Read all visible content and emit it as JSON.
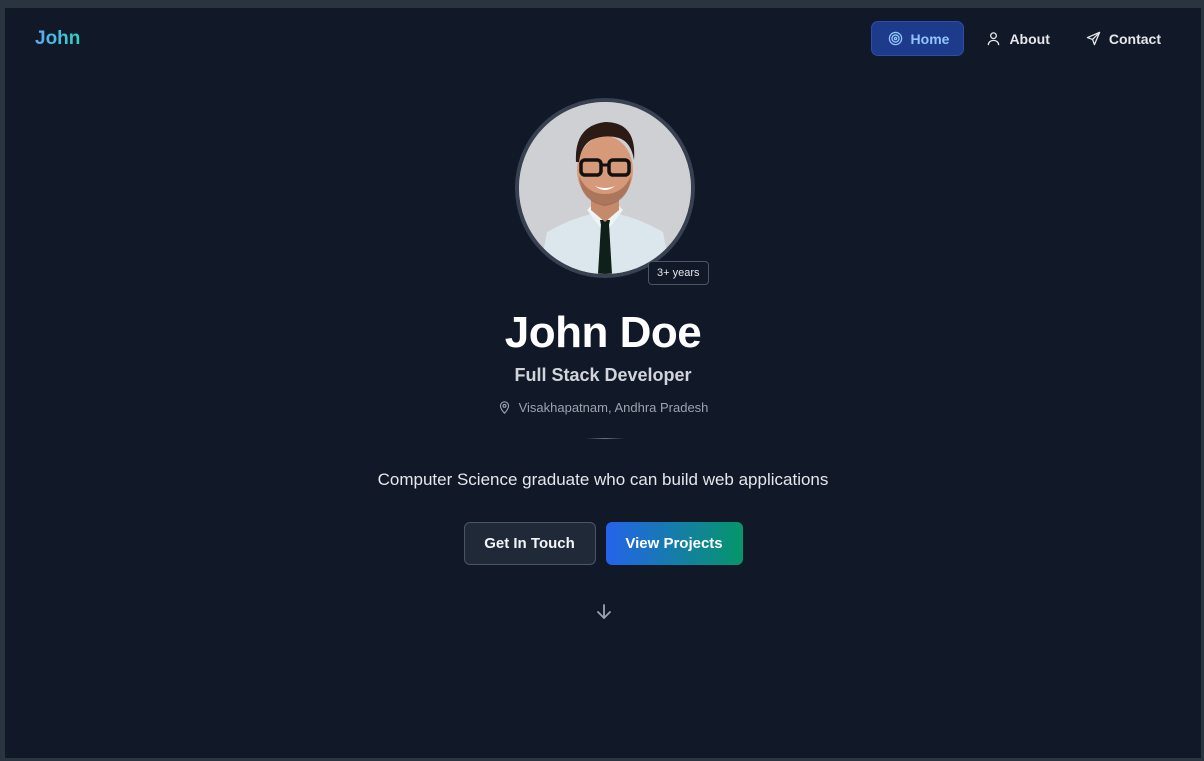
{
  "nav": {
    "brand": "John",
    "links": [
      {
        "label": "Home",
        "icon": "target-icon",
        "active": true
      },
      {
        "label": "About",
        "icon": "user-icon",
        "active": false
      },
      {
        "label": "Contact",
        "icon": "send-icon",
        "active": false
      }
    ]
  },
  "hero": {
    "experience_badge": "3+ years",
    "name": "John Doe",
    "role": "Full Stack Developer",
    "location": "Visakhapatnam, Andhra Pradesh",
    "tagline": "Computer Science graduate who can build web applications",
    "buttons": {
      "contact": "Get In Touch",
      "projects": "View Projects"
    },
    "scroll_icon": "arrow-down-icon"
  },
  "colors": {
    "background": "#111827",
    "active_nav": "#1e3a8a",
    "primary_gradient_start": "#2563eb",
    "primary_gradient_end": "#059669"
  }
}
